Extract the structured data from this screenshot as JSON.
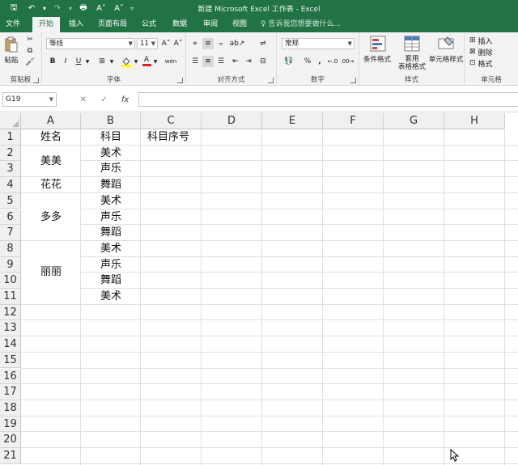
{
  "titlebar": {
    "title": "新建 Microsoft Excel 工作表 - Excel",
    "qat": [
      {
        "name": "save-icon",
        "glyph": "🖫"
      },
      {
        "name": "undo-icon",
        "glyph": "↶"
      },
      {
        "name": "undo-dropdown-icon",
        "glyph": "▾"
      },
      {
        "name": "redo-icon",
        "glyph": "↷"
      },
      {
        "name": "redo-dropdown-icon",
        "glyph": "▾"
      },
      {
        "name": "print-icon",
        "glyph": "🖶"
      },
      {
        "name": "font-increase-icon",
        "glyph": "A˄"
      },
      {
        "name": "font-decrease-icon",
        "glyph": "A˅"
      },
      {
        "name": "customize-qat-icon",
        "glyph": "▿"
      }
    ]
  },
  "tabs": [
    "文件",
    "开始",
    "插入",
    "页面布局",
    "公式",
    "数据",
    "审阅",
    "视图"
  ],
  "active_tab": "开始",
  "tell_me": "告诉我您想要做什么...",
  "ribbon": {
    "clipboard": {
      "label": "剪贴板",
      "paste": "粘贴"
    },
    "font": {
      "label": "字体",
      "font_name": "等线",
      "font_size": "11",
      "grow": "A˄",
      "shrink": "A˅",
      "bold": "B",
      "italic": "I",
      "underline": "U",
      "font_color": "A",
      "wen": "wén"
    },
    "alignment": {
      "label": "对齐方式"
    },
    "number": {
      "label": "数字",
      "format": "常规",
      "percent": "%",
      "comma": ","
    },
    "styles": {
      "label": "样式",
      "conditional": "条件格式",
      "table_format_1": "套用",
      "table_format_2": "表格格式",
      "cell_styles": "单元格样式"
    },
    "cells": {
      "label": "单元格",
      "insert": "插入",
      "delete": "删除",
      "format": "格式"
    }
  },
  "formula_bar": {
    "name_box": "G19",
    "cancel": "✕",
    "enter": "✓",
    "fx": "fx",
    "content": ""
  },
  "grid": {
    "columns": [
      "A",
      "B",
      "C",
      "D",
      "E",
      "F",
      "G",
      "H"
    ],
    "rows": [
      "1",
      "2",
      "3",
      "4",
      "5",
      "6",
      "7",
      "8",
      "9",
      "10",
      "11",
      "12",
      "13",
      "14",
      "15",
      "16",
      "17",
      "18",
      "19",
      "20",
      "21"
    ],
    "headers": {
      "A1": "姓名",
      "B1": "科目",
      "C1": "科目序号"
    },
    "names": [
      {
        "value": "美美",
        "rows": [
          2,
          3
        ]
      },
      {
        "value": "花花",
        "rows": [
          4,
          4
        ]
      },
      {
        "value": "多多",
        "rows": [
          5,
          7
        ]
      },
      {
        "value": "丽丽",
        "rows": [
          8,
          11
        ]
      }
    ],
    "subjects": [
      "美术",
      "声乐",
      "舞蹈",
      "美术",
      "声乐",
      "舞蹈",
      "美术",
      "声乐",
      "舞蹈",
      "美术"
    ]
  }
}
